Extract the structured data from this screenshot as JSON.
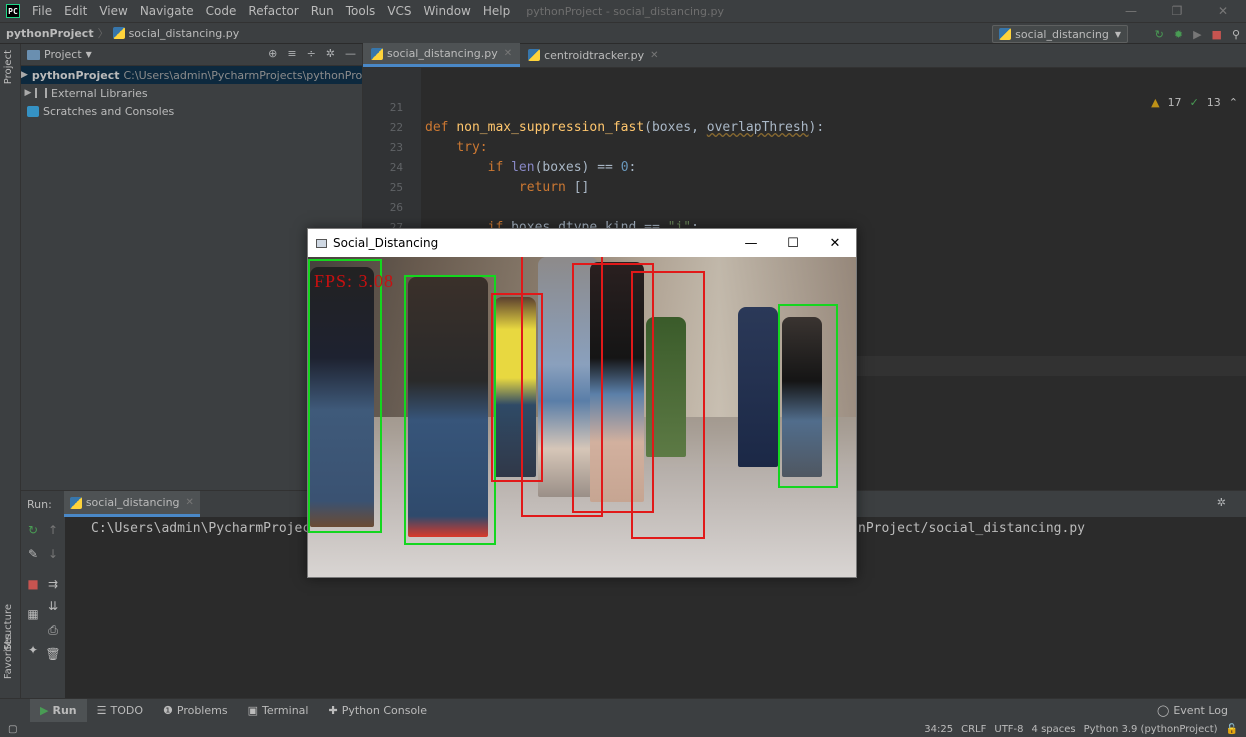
{
  "menubar": {
    "logo": "PC",
    "items": [
      "File",
      "Edit",
      "View",
      "Navigate",
      "Code",
      "Refactor",
      "Run",
      "Tools",
      "VCS",
      "Window",
      "Help"
    ],
    "window_title": "pythonProject - social_distancing.py"
  },
  "navbar": {
    "project": "pythonProject",
    "file": "social_distancing.py",
    "run_config": "social_distancing"
  },
  "left_stripe": {
    "project_tab": "Project",
    "structure_tab": "Structure",
    "favorites_tab": "Favorites"
  },
  "project_panel": {
    "title": "Project",
    "tree": [
      {
        "label": "pythonProject",
        "path": "C:\\Users\\admin\\PycharmProjects\\pythonProj"
      },
      {
        "label": "External Libraries"
      },
      {
        "label": "Scratches and Consoles"
      }
    ]
  },
  "editor": {
    "tabs": [
      {
        "label": "social_distancing.py",
        "active": true
      },
      {
        "label": "centroidtracker.py",
        "active": false
      }
    ],
    "inspections": {
      "warnings": "17",
      "ok": "13"
    },
    "line_numbers": [
      "21",
      "22",
      "23",
      "24",
      "25",
      "26",
      "27"
    ],
    "code": {
      "l22_kw": "def ",
      "l22_fn": "non_max_suppression_fast",
      "l22_open": "(boxes, ",
      "l22_param": "overlapThresh",
      "l22_close": "):",
      "l23": "try:",
      "l24_kw": "if ",
      "l24_bi": "len",
      "l24_rest": "(boxes) == ",
      "l24_num": "0",
      "l24_end": ":",
      "l25_kw": "return ",
      "l25_rest": "[]",
      "l27_kw": "if ",
      "l27_rest": "boxes.dtype.kind == ",
      "l27_str": "\"i\"",
      "l27_end": ":"
    }
  },
  "run_panel": {
    "label": "Run:",
    "tab": "social_distancing",
    "console_line_start": "C:\\Users\\admin\\PycharmProjects",
    "console_line_end": "nProject/social_distancing.py"
  },
  "bottom_toolbar": {
    "items": [
      "Run",
      "TODO",
      "Problems",
      "Terminal",
      "Python Console"
    ],
    "event_log": "Event Log"
  },
  "statusbar": {
    "position": "34:25",
    "line_sep": "CRLF",
    "encoding": "UTF-8",
    "indent": "4 spaces",
    "interpreter": "Python 3.9 (pythonProject)"
  },
  "cv_window": {
    "title": "Social_Distancing",
    "fps_text": "FPS: 3.08",
    "box_colors": {
      "safe": "#14d61f",
      "violation": "#e11919"
    }
  },
  "colors": {
    "accent": "#4a88c7",
    "background": "#2b2b2b",
    "panel": "#3c3f41"
  }
}
